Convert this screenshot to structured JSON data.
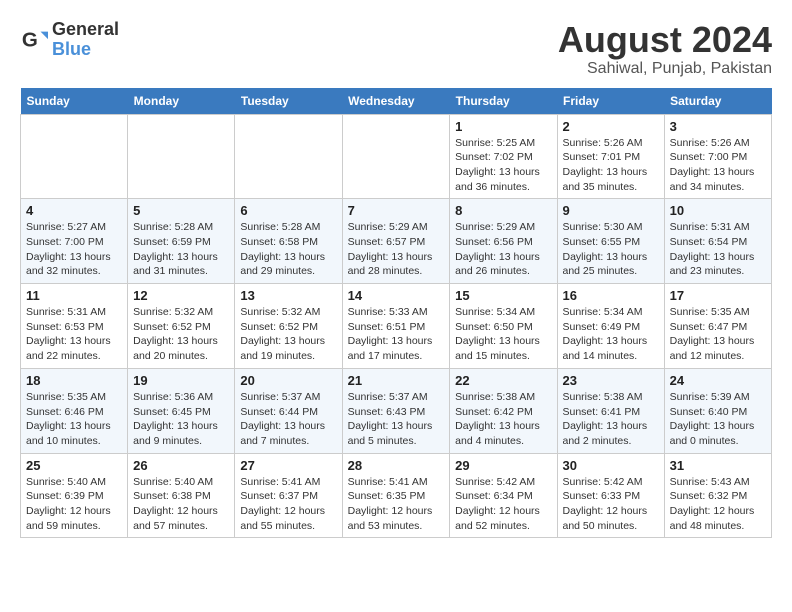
{
  "header": {
    "logo_line1": "General",
    "logo_line2": "Blue",
    "title": "August 2024",
    "subtitle": "Sahiwal, Punjab, Pakistan"
  },
  "weekdays": [
    "Sunday",
    "Monday",
    "Tuesday",
    "Wednesday",
    "Thursday",
    "Friday",
    "Saturday"
  ],
  "weeks": [
    [
      {
        "day": "",
        "info": ""
      },
      {
        "day": "",
        "info": ""
      },
      {
        "day": "",
        "info": ""
      },
      {
        "day": "",
        "info": ""
      },
      {
        "day": "1",
        "info": "Sunrise: 5:25 AM\nSunset: 7:02 PM\nDaylight: 13 hours\nand 36 minutes."
      },
      {
        "day": "2",
        "info": "Sunrise: 5:26 AM\nSunset: 7:01 PM\nDaylight: 13 hours\nand 35 minutes."
      },
      {
        "day": "3",
        "info": "Sunrise: 5:26 AM\nSunset: 7:00 PM\nDaylight: 13 hours\nand 34 minutes."
      }
    ],
    [
      {
        "day": "4",
        "info": "Sunrise: 5:27 AM\nSunset: 7:00 PM\nDaylight: 13 hours\nand 32 minutes."
      },
      {
        "day": "5",
        "info": "Sunrise: 5:28 AM\nSunset: 6:59 PM\nDaylight: 13 hours\nand 31 minutes."
      },
      {
        "day": "6",
        "info": "Sunrise: 5:28 AM\nSunset: 6:58 PM\nDaylight: 13 hours\nand 29 minutes."
      },
      {
        "day": "7",
        "info": "Sunrise: 5:29 AM\nSunset: 6:57 PM\nDaylight: 13 hours\nand 28 minutes."
      },
      {
        "day": "8",
        "info": "Sunrise: 5:29 AM\nSunset: 6:56 PM\nDaylight: 13 hours\nand 26 minutes."
      },
      {
        "day": "9",
        "info": "Sunrise: 5:30 AM\nSunset: 6:55 PM\nDaylight: 13 hours\nand 25 minutes."
      },
      {
        "day": "10",
        "info": "Sunrise: 5:31 AM\nSunset: 6:54 PM\nDaylight: 13 hours\nand 23 minutes."
      }
    ],
    [
      {
        "day": "11",
        "info": "Sunrise: 5:31 AM\nSunset: 6:53 PM\nDaylight: 13 hours\nand 22 minutes."
      },
      {
        "day": "12",
        "info": "Sunrise: 5:32 AM\nSunset: 6:52 PM\nDaylight: 13 hours\nand 20 minutes."
      },
      {
        "day": "13",
        "info": "Sunrise: 5:32 AM\nSunset: 6:52 PM\nDaylight: 13 hours\nand 19 minutes."
      },
      {
        "day": "14",
        "info": "Sunrise: 5:33 AM\nSunset: 6:51 PM\nDaylight: 13 hours\nand 17 minutes."
      },
      {
        "day": "15",
        "info": "Sunrise: 5:34 AM\nSunset: 6:50 PM\nDaylight: 13 hours\nand 15 minutes."
      },
      {
        "day": "16",
        "info": "Sunrise: 5:34 AM\nSunset: 6:49 PM\nDaylight: 13 hours\nand 14 minutes."
      },
      {
        "day": "17",
        "info": "Sunrise: 5:35 AM\nSunset: 6:47 PM\nDaylight: 13 hours\nand 12 minutes."
      }
    ],
    [
      {
        "day": "18",
        "info": "Sunrise: 5:35 AM\nSunset: 6:46 PM\nDaylight: 13 hours\nand 10 minutes."
      },
      {
        "day": "19",
        "info": "Sunrise: 5:36 AM\nSunset: 6:45 PM\nDaylight: 13 hours\nand 9 minutes."
      },
      {
        "day": "20",
        "info": "Sunrise: 5:37 AM\nSunset: 6:44 PM\nDaylight: 13 hours\nand 7 minutes."
      },
      {
        "day": "21",
        "info": "Sunrise: 5:37 AM\nSunset: 6:43 PM\nDaylight: 13 hours\nand 5 minutes."
      },
      {
        "day": "22",
        "info": "Sunrise: 5:38 AM\nSunset: 6:42 PM\nDaylight: 13 hours\nand 4 minutes."
      },
      {
        "day": "23",
        "info": "Sunrise: 5:38 AM\nSunset: 6:41 PM\nDaylight: 13 hours\nand 2 minutes."
      },
      {
        "day": "24",
        "info": "Sunrise: 5:39 AM\nSunset: 6:40 PM\nDaylight: 13 hours\nand 0 minutes."
      }
    ],
    [
      {
        "day": "25",
        "info": "Sunrise: 5:40 AM\nSunset: 6:39 PM\nDaylight: 12 hours\nand 59 minutes."
      },
      {
        "day": "26",
        "info": "Sunrise: 5:40 AM\nSunset: 6:38 PM\nDaylight: 12 hours\nand 57 minutes."
      },
      {
        "day": "27",
        "info": "Sunrise: 5:41 AM\nSunset: 6:37 PM\nDaylight: 12 hours\nand 55 minutes."
      },
      {
        "day": "28",
        "info": "Sunrise: 5:41 AM\nSunset: 6:35 PM\nDaylight: 12 hours\nand 53 minutes."
      },
      {
        "day": "29",
        "info": "Sunrise: 5:42 AM\nSunset: 6:34 PM\nDaylight: 12 hours\nand 52 minutes."
      },
      {
        "day": "30",
        "info": "Sunrise: 5:42 AM\nSunset: 6:33 PM\nDaylight: 12 hours\nand 50 minutes."
      },
      {
        "day": "31",
        "info": "Sunrise: 5:43 AM\nSunset: 6:32 PM\nDaylight: 12 hours\nand 48 minutes."
      }
    ]
  ]
}
